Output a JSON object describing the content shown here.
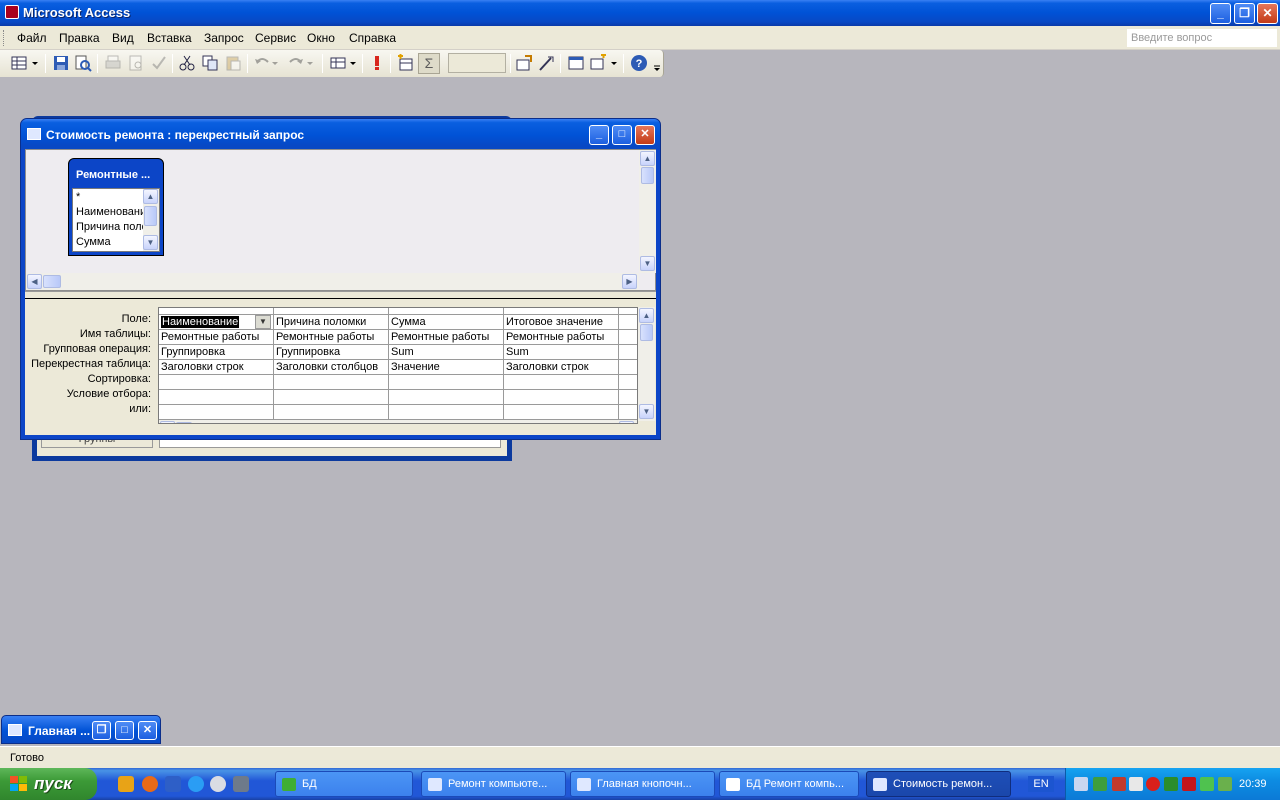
{
  "app": {
    "title": "Microsoft Access",
    "window_buttons": {
      "minimize": "_",
      "restore": "❐",
      "close": "✕"
    }
  },
  "menu": {
    "items": [
      "Файл",
      "Правка",
      "Вид",
      "Вставка",
      "Запрос",
      "Сервис",
      "Окно",
      "Справка"
    ],
    "ask_placeholder": "Введите вопрос"
  },
  "toolbar": {
    "sigma": "Σ",
    "icons": [
      "view-icon",
      "save-icon",
      "search-icon",
      "print-icon",
      "print-preview-icon",
      "spelling-icon",
      "cut-icon",
      "copy-icon",
      "paste-icon",
      "undo-icon",
      "redo-icon",
      "query-type-icon",
      "run-icon",
      "show-table-icon",
      "totals-icon",
      "properties-icon",
      "builder-icon",
      "database-window-icon",
      "new-object-icon",
      "help-icon"
    ]
  },
  "background_window": {
    "button_label": "Группы"
  },
  "query_window": {
    "title": "Стоимость ремонта : перекрестный запрос",
    "field_list": {
      "title": "Ремонтные ...",
      "items": [
        "*",
        "Наименование",
        "Причина поломки",
        "Сумма"
      ]
    },
    "row_labels": [
      "Поле:",
      "Имя таблицы:",
      "Групповая операция:",
      "Перекрестная таблица:",
      "Сортировка:",
      "Условие отбора:",
      "или:"
    ],
    "columns": [
      {
        "field": "Наименование",
        "table": "Ремонтные работы",
        "group": "Группировка",
        "crosstab": "Заголовки строк"
      },
      {
        "field": "Причина поломки",
        "table": "Ремонтные работы",
        "group": "Группировка",
        "crosstab": "Заголовки столбцов"
      },
      {
        "field": "Сумма",
        "table": "Ремонтные работы",
        "group": "Sum",
        "crosstab": "Значение"
      },
      {
        "field": "Итоговое значение",
        "table": "Ремонтные работы",
        "group": "Sum",
        "crosstab": "Заголовки строк"
      }
    ]
  },
  "minimized_window": {
    "title": "Главная ..."
  },
  "status": {
    "text": "Готово"
  },
  "taskbar": {
    "start_label": "пуск",
    "tasks": [
      {
        "label": "БД",
        "active": false
      },
      {
        "label": "Ремонт компьюте...",
        "active": false
      },
      {
        "label": "Главная кнопочн...",
        "active": false
      },
      {
        "label": "БД Ремонт компь...",
        "active": false
      },
      {
        "label": "Стоимость ремон...",
        "active": true
      }
    ],
    "language": "EN",
    "clock": "20:39"
  }
}
